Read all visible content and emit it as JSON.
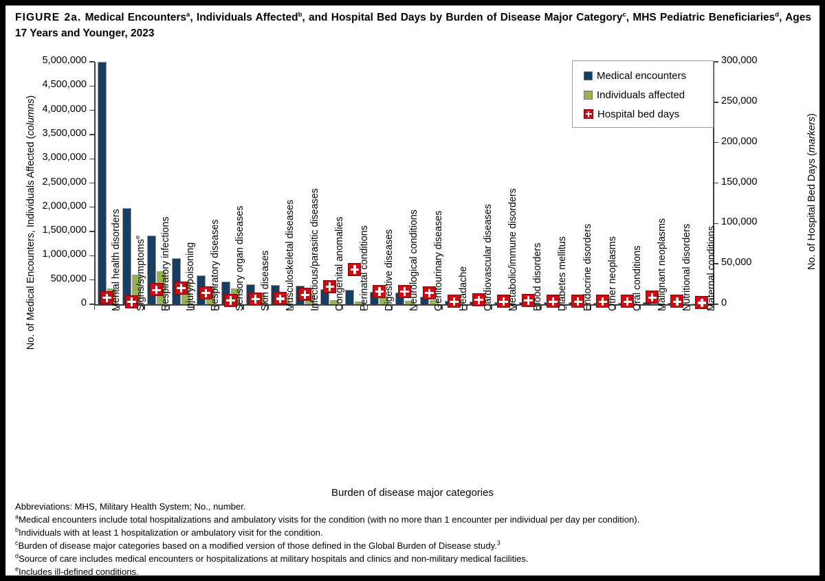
{
  "figure": {
    "number": "FIGURE 2a.",
    "title_part1": "Medical Encounters",
    "sup_a": "a",
    "title_part2": ", Individuals Affected",
    "sup_b": "b",
    "title_part3": ", and Hospital Bed Days by Burden of Disease Major Category",
    "sup_c": "c",
    "title_part4": ", MHS Pediatric Beneficiaries",
    "sup_d": "d",
    "title_part5": ", Ages 17 Years and Younger, 2023"
  },
  "axes": {
    "y_left_title": "No. of Medical Encounters, Individuals Affected (columns)",
    "y_left_title_plain": "No. of Medical Encounters, Individuals Affected (",
    "y_left_title_italic": "columns",
    "y_left_title_close": ")",
    "y_right_title_plain": "No. of Hospital Bed Days (",
    "y_right_title_italic": "markers",
    "y_right_title_close": ")",
    "x_title": "Burden of disease major categories"
  },
  "legend": {
    "items": [
      {
        "label": "Medical encounters",
        "color": "#153E63",
        "type": "column"
      },
      {
        "label": "Individuals affected",
        "color": "#97B350",
        "type": "column"
      },
      {
        "label": "Hospital bed days",
        "color": "#CF0A12",
        "type": "marker"
      }
    ]
  },
  "notes": {
    "abbreviations": "Abbreviations: MHS, Military Health System; No., number.",
    "a": "Medical encounters include total hospitalizations and ambulatory visits for the condition (with no more than 1 encounter per individual per day per condition).",
    "b": "Individuals with at least 1 hospitalization or ambulatory visit for the condition.",
    "c_text": "Burden of disease major categories based on a modified version of those defined in the Global Burden of Disease study.",
    "c_sup": "3",
    "d": "Source of care includes medical encounters or hospitalizations at military hospitals and clinics and non-military medical facilities.",
    "e": "Includes ill-defined conditions."
  },
  "chart_data": {
    "type": "bar",
    "title": "Medical Encounters, Individuals Affected, and Hospital Bed Days by Burden of Disease Major Category, MHS Pediatric Beneficiaries, Ages 17 Years and Younger, 2023",
    "xlabel": "Burden of disease major categories",
    "ylabel": "No. of Medical Encounters, Individuals Affected (columns)",
    "y2label": "No. of Hospital Bed Days (markers)",
    "ylim": [
      0,
      5000000
    ],
    "y2lim": [
      0,
      300000
    ],
    "yticks": [
      "0",
      "500,000",
      "1,000,000",
      "1,500,000",
      "2,000,000",
      "2,500,000",
      "3,000,000",
      "3,500,000",
      "4,000,000",
      "4,500,000",
      "5,000,000"
    ],
    "y2ticks": [
      "0",
      "50,000",
      "100,000",
      "150,000",
      "200,000",
      "250,000",
      "300,000"
    ],
    "grid": false,
    "legend_position": "top-right",
    "categories": [
      "Mental health disorders",
      "Signs/symptoms",
      "Respiratory infections",
      "Injury/poisoning",
      "Respiratory diseases",
      "Sensory organ diseases",
      "Skin diseases",
      "Musculoskeletal diseases",
      "Infectious/parasitic diseases",
      "Congenital anomalies",
      "Perinatal conditions",
      "Digestive diseases",
      "Neurological conditions",
      "Genitourinary diseases",
      "Headache",
      "Cardiovascular diseases",
      "Metabolic/immune disorders",
      "Blood disorders",
      "Diabetes mellitus",
      "Endocrine disorders",
      "Other neoplasms",
      "Oral conditions",
      "Malignant neoplasms",
      "Nutritional disorders",
      "Maternal conditions"
    ],
    "category_superscripts": {
      "Signs/symptoms": "e"
    },
    "series": [
      {
        "name": "Medical encounters",
        "axis": "left",
        "color": "#153E63",
        "values": [
          4995000,
          1985000,
          1410000,
          945000,
          600000,
          470000,
          415000,
          390000,
          380000,
          310000,
          300000,
          255000,
          240000,
          160000,
          70000,
          62000,
          48000,
          40000,
          38000,
          36000,
          34000,
          32000,
          45000,
          30000,
          10000
        ]
      },
      {
        "name": "Individuals affected",
        "axis": "left",
        "color": "#97B350",
        "values": [
          330000,
          610000,
          685000,
          470000,
          350000,
          330000,
          240000,
          135000,
          215000,
          85000,
          60000,
          155000,
          75000,
          85000,
          40000,
          30000,
          25000,
          18000,
          12000,
          20000,
          18000,
          22000,
          9000,
          16000,
          6000
        ]
      },
      {
        "name": "Hospital bed days",
        "axis": "right",
        "color": "#CF0A12",
        "marker": "plus-square",
        "values": [
          8000,
          3000,
          18000,
          20000,
          14000,
          5000,
          6500,
          7000,
          12000,
          22000,
          43000,
          16000,
          16000,
          14000,
          3500,
          5500,
          3500,
          5000,
          3500,
          3500,
          3500,
          3500,
          8500,
          3500,
          2000
        ]
      }
    ]
  }
}
